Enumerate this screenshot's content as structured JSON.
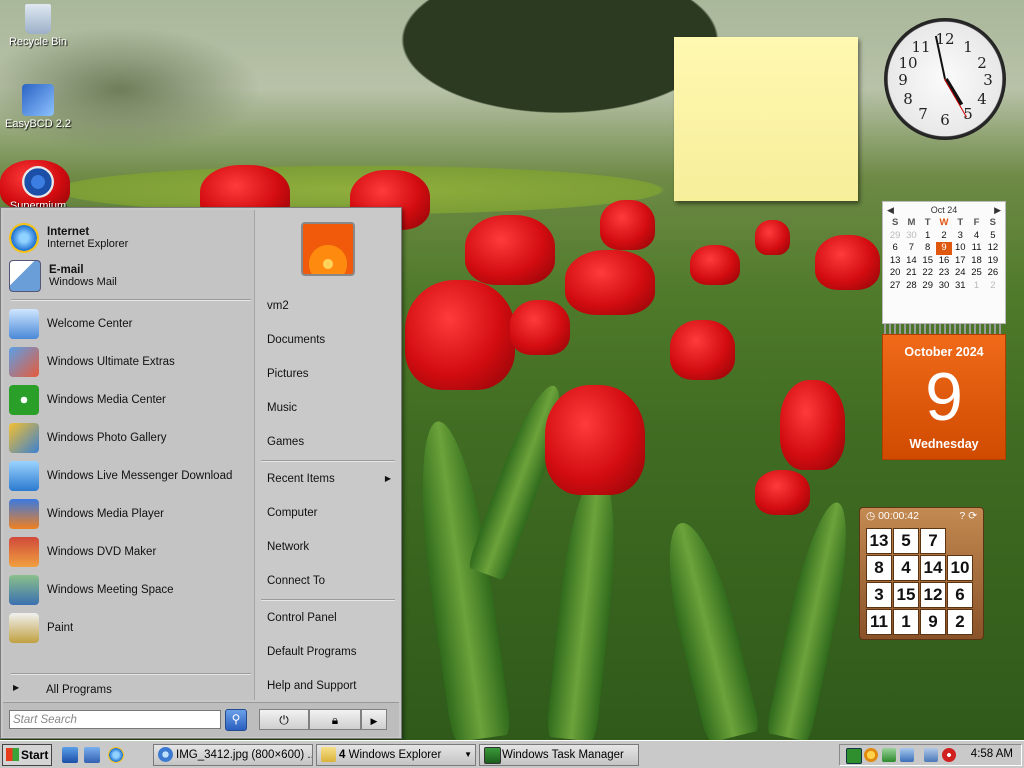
{
  "desktop": {
    "icons": [
      {
        "label": "Recycle Bin",
        "icon": "recycle-bin-icon"
      },
      {
        "label": "EasyBCD 2.2",
        "icon": "easybcd-icon"
      },
      {
        "label": "Supermium",
        "icon": "supermium-icon"
      }
    ]
  },
  "gadgets": {
    "clock": {
      "time": "4:58"
    },
    "calendar": {
      "nav_month": "Oct 24",
      "weekdays": [
        "S",
        "M",
        "T",
        "W",
        "T",
        "F",
        "S"
      ],
      "weeks": [
        [
          "29",
          "30",
          "1",
          "2",
          "3",
          "4",
          "5"
        ],
        [
          "6",
          "7",
          "8",
          "9",
          "10",
          "11",
          "12"
        ],
        [
          "13",
          "14",
          "15",
          "16",
          "17",
          "18",
          "19"
        ],
        [
          "20",
          "21",
          "22",
          "23",
          "24",
          "25",
          "26"
        ],
        [
          "27",
          "28",
          "29",
          "30",
          "31",
          "1",
          "2"
        ]
      ],
      "month_year": "October 2024",
      "day": "9",
      "weekday": "Wednesday"
    },
    "puzzle": {
      "timer": "00:00:42",
      "tiles": [
        "13",
        "5",
        "7",
        "",
        "8",
        "4",
        "14",
        "10",
        "3",
        "15",
        "12",
        "6",
        "11",
        "1",
        "9",
        "2"
      ]
    }
  },
  "start_menu": {
    "pinned": [
      {
        "title": "Internet",
        "subtitle": "Internet Explorer"
      },
      {
        "title": "E-mail",
        "subtitle": "Windows Mail"
      }
    ],
    "programs": [
      "Welcome Center",
      "Windows Ultimate Extras",
      "Windows Media Center",
      "Windows Photo Gallery",
      "Windows Live Messenger Download",
      "Windows Media Player",
      "Windows DVD Maker",
      "Windows Meeting Space",
      "Paint"
    ],
    "all_programs": "All Programs",
    "right_items": {
      "user": "vm2",
      "documents": "Documents",
      "pictures": "Pictures",
      "music": "Music",
      "games": "Games",
      "recent": "Recent Items",
      "computer": "Computer",
      "network": "Network",
      "connect": "Connect To",
      "control_panel": "Control Panel",
      "default_programs": "Default Programs",
      "help": "Help and Support"
    },
    "search_placeholder": "Start Search"
  },
  "taskbar": {
    "start_label": "Start",
    "buttons": [
      {
        "label": "IMG_3412.jpg (800×600) ..."
      },
      {
        "count": "4",
        "label": "Windows Explorer"
      },
      {
        "label": "Windows Task Manager"
      }
    ],
    "clock": "4:58 AM"
  }
}
